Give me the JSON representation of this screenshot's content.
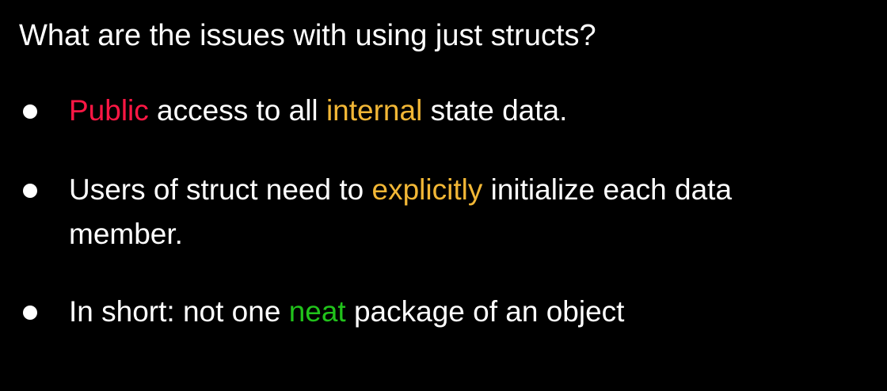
{
  "slide": {
    "title": "What are the issues with using just structs?",
    "colors": {
      "background": "#000000",
      "text": "#ffffff",
      "red": "#ff1744",
      "orange": "#f2b736",
      "green": "#21c21b"
    },
    "bullets": [
      {
        "before": "",
        "highlight1": "Public",
        "middle": " access to all ",
        "highlight2": "internal",
        "after": " state data."
      },
      {
        "before": "Users of struct need to ",
        "highlight": "explicitly",
        "after_line1": " initialize each data",
        "line2": "member."
      },
      {
        "before": "In short: not one ",
        "highlight": "neat",
        "after": " package of an object"
      }
    ]
  }
}
